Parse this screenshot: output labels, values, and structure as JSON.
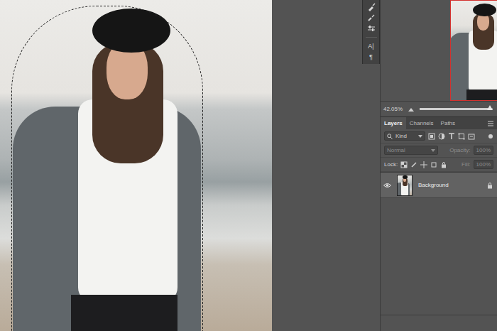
{
  "toolbar": {
    "glyphs": [
      "A|",
      "¶"
    ]
  },
  "navigator": {
    "zoom": "42.05%",
    "level": 0.96
  },
  "tabs": [
    {
      "label": "Layers",
      "selected": true
    },
    {
      "label": "Channels",
      "selected": false
    },
    {
      "label": "Paths",
      "selected": false
    }
  ],
  "filter": {
    "label": "Kind"
  },
  "blend_mode": {
    "value": "Normal",
    "disabled": true
  },
  "opacity": {
    "label": "Opacity:",
    "value": "100%",
    "disabled": true
  },
  "lock": {
    "label": "Lock:"
  },
  "fill": {
    "label": "Fill:",
    "value": "100%",
    "disabled": true
  },
  "layers": [
    {
      "name": "Background",
      "visible": true,
      "selected": true,
      "locked": true
    }
  ]
}
